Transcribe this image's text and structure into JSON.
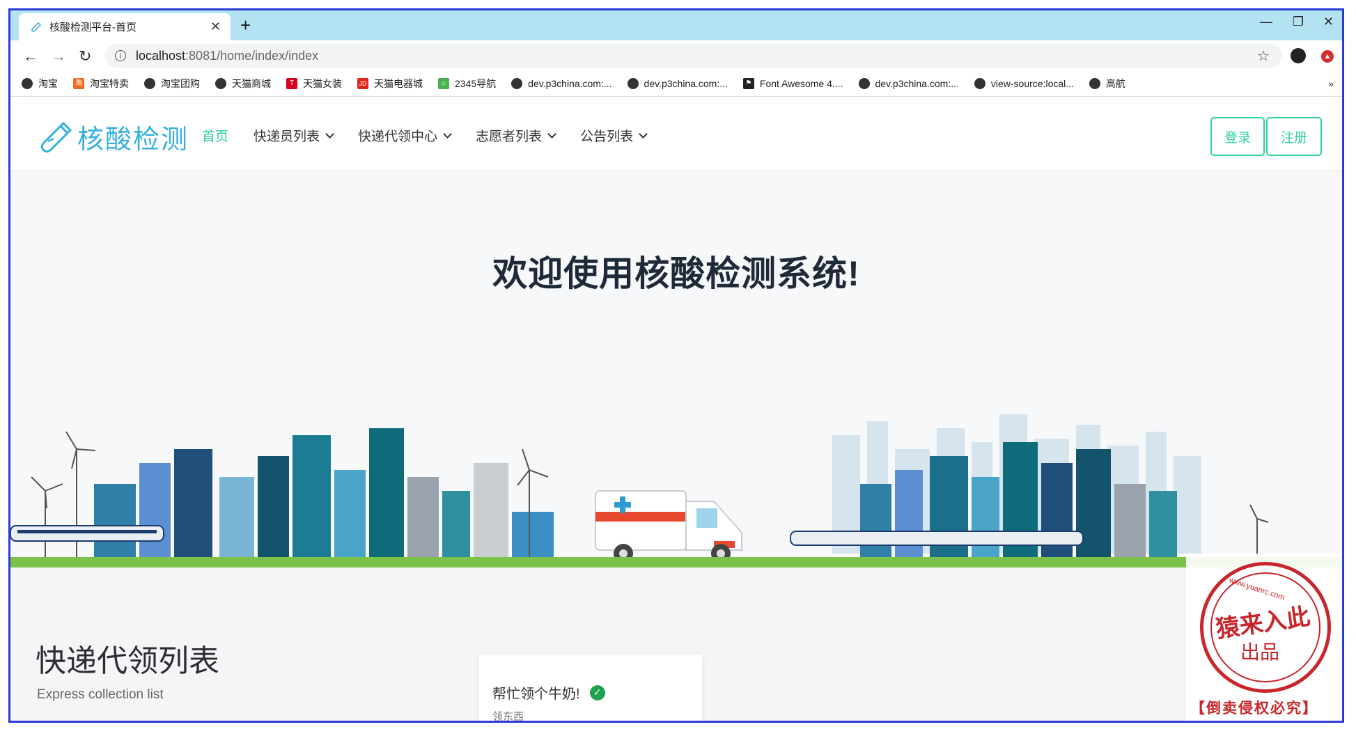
{
  "browser": {
    "tab_title": "核酸检测平台-首页",
    "url_host": "localhost",
    "url_rest": ":8081/home/index/index",
    "bookmarks": [
      {
        "label": "淘宝",
        "icon": "globe-icon"
      },
      {
        "label": "淘宝特卖",
        "icon": "taobao-sale-icon"
      },
      {
        "label": "淘宝团购",
        "icon": "globe-icon"
      },
      {
        "label": "天猫商城",
        "icon": "globe-icon"
      },
      {
        "label": "天猫女装",
        "icon": "tmall-icon"
      },
      {
        "label": "天猫电器城",
        "icon": "jd-icon"
      },
      {
        "label": "2345导航",
        "icon": "2345-icon"
      },
      {
        "label": "dev.p3china.com:...",
        "icon": "globe-icon"
      },
      {
        "label": "dev.p3china.com:...",
        "icon": "globe-icon"
      },
      {
        "label": "Font Awesome 4....",
        "icon": "flag-icon"
      },
      {
        "label": "dev.p3china.com:...",
        "icon": "globe-icon"
      },
      {
        "label": "view-source:local...",
        "icon": "globe-icon"
      },
      {
        "label": "高航",
        "icon": "globe-icon"
      }
    ],
    "more_label": "»"
  },
  "site": {
    "logo_text": "核酸检测",
    "nav": [
      {
        "label": "首页",
        "active": true,
        "dropdown": false
      },
      {
        "label": "快递员列表",
        "active": false,
        "dropdown": true
      },
      {
        "label": "快递代领中心",
        "active": false,
        "dropdown": true
      },
      {
        "label": "志愿者列表",
        "active": false,
        "dropdown": true
      },
      {
        "label": "公告列表",
        "active": false,
        "dropdown": true
      }
    ],
    "login_label": "登录",
    "register_label": "注册",
    "accent_color": "#21c8a0"
  },
  "hero": {
    "title": "欢迎使用核酸检测系统!"
  },
  "section": {
    "title": "快递代领列表",
    "subtitle": "Express collection list",
    "card": {
      "title": "帮忙领个牛奶!",
      "subtitle": "领东西"
    }
  },
  "stamp": {
    "url": "www.yuanrc.com",
    "main": "猿来入此",
    "sub": "出品",
    "footer": "【倒卖侵权必究】"
  }
}
